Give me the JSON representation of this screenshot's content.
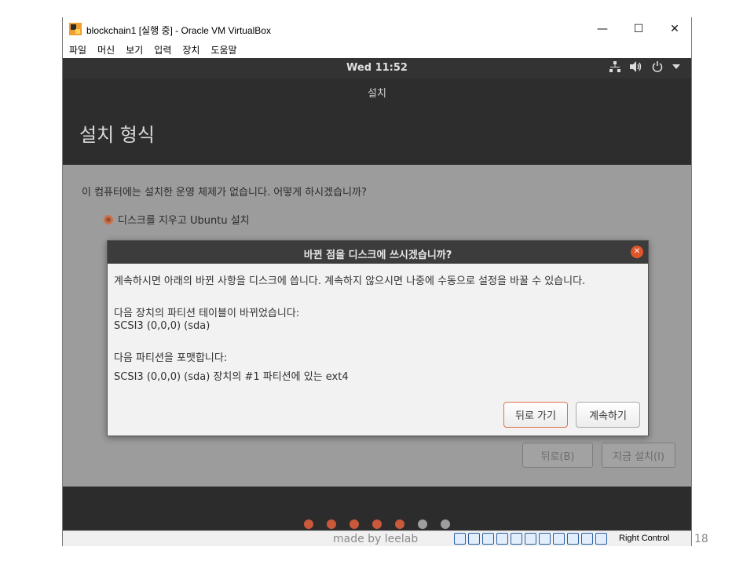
{
  "window": {
    "title": "blockchain1 [실행 중] - Oracle VM VirtualBox",
    "minimize": "—",
    "maximize": "☐",
    "close": "✕"
  },
  "menu": {
    "items": [
      {
        "label": "파일"
      },
      {
        "label": "머신"
      },
      {
        "label": "보기"
      },
      {
        "label": "입력"
      },
      {
        "label": "장치"
      },
      {
        "label": "도움말"
      }
    ]
  },
  "guest": {
    "topbar": {
      "time": "Wed 11:52",
      "network_icon": "network-icon",
      "volume_icon": "volume-icon",
      "power_icon": "power-icon"
    },
    "installer": {
      "caption": "설치",
      "heading": "설치 형식",
      "question": "이 컴퓨터에는 설치한 운영 체제가 없습니다. 어떻게 하시겠습니까?",
      "option_selected": "디스크를 지우고 Ubuntu 설치",
      "back_button": "뒤로(B)",
      "install_button": "지금 설치(I)",
      "progress": {
        "total_steps": 7,
        "completed_steps": 5,
        "active_color": "#c9593a",
        "inactive_color": "#9e9e9e"
      }
    },
    "dialog": {
      "title": "바뀐 점을 디스크에 쓰시겠습니까?",
      "intro": "계속하시면 아래의 바뀐 사항을 디스크에 씁니다. 계속하지 않으시면 나중에 수동으로 설정을 바꿀 수 있습니다.",
      "partition_table_heading": "다음 장치의 파티션 테이블이 바뀌었습니다:",
      "partition_table_device": "SCSI3 (0,0,0) (sda)",
      "format_heading": "다음 파티션을 포맷합니다:",
      "format_target": "SCSI3 (0,0,0) (sda) 장치의 #1 파티션에 있는 ext4",
      "back_button": "뒤로 가기",
      "continue_button": "계속하기"
    }
  },
  "statusbar": {
    "host_key": "Right Control"
  },
  "slide": {
    "watermark": "made by leelab",
    "page_number": "18"
  },
  "colors": {
    "accent": "#e95420",
    "dialog_bg": "#f2f2f2",
    "guest_dark": "#2c2c2c"
  }
}
